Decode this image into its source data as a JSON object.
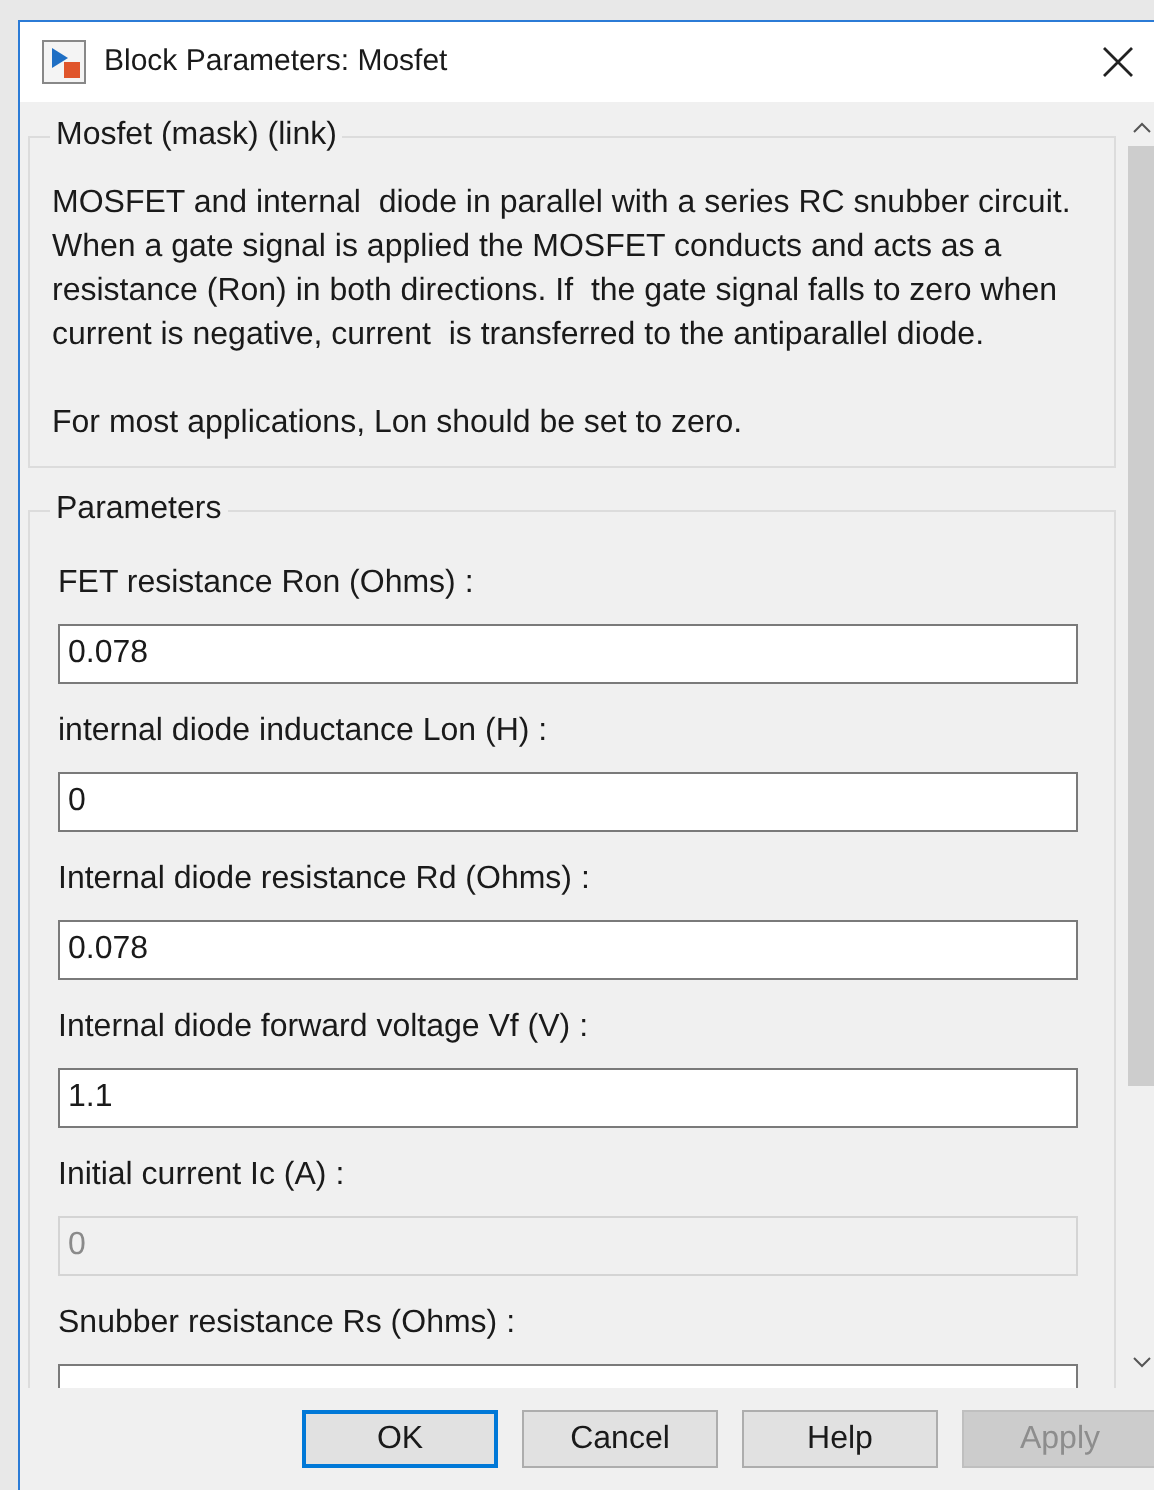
{
  "window": {
    "title": "Block Parameters: Mosfet"
  },
  "mask_group": {
    "title": "Mosfet (mask) (link)",
    "paragraphs": [
      "MOSFET and internal  diode in parallel with a series RC snubber circuit. When a gate signal is applied the MOSFET conducts and acts as a resistance (Ron) in both directions. If  the gate signal falls to zero when current is negative, current  is transferred to the antiparallel diode.",
      "For most applications, Lon should be set to zero."
    ]
  },
  "parameters_group": {
    "title": "Parameters",
    "fields": [
      {
        "label": "FET resistance Ron (Ohms) :",
        "value": "0.078",
        "disabled": false
      },
      {
        "label": "internal diode inductance Lon (H) :",
        "value": "0",
        "disabled": false
      },
      {
        "label": "Internal diode resistance Rd  (Ohms) :",
        "value": "0.078",
        "disabled": false
      },
      {
        "label": "Internal diode forward voltage Vf (V) :",
        "value": "1.1",
        "disabled": false
      },
      {
        "label": "Initial current Ic (A) :",
        "value": "0",
        "disabled": true
      },
      {
        "label": "Snubber resistance Rs (Ohms) :",
        "disabled": false
      }
    ]
  },
  "buttons": [
    {
      "label": "OK",
      "default": true,
      "disabled": false
    },
    {
      "label": "Cancel",
      "default": false,
      "disabled": false
    },
    {
      "label": "Help",
      "default": false,
      "disabled": false
    },
    {
      "label": "Apply",
      "default": false,
      "disabled": true
    }
  ]
}
